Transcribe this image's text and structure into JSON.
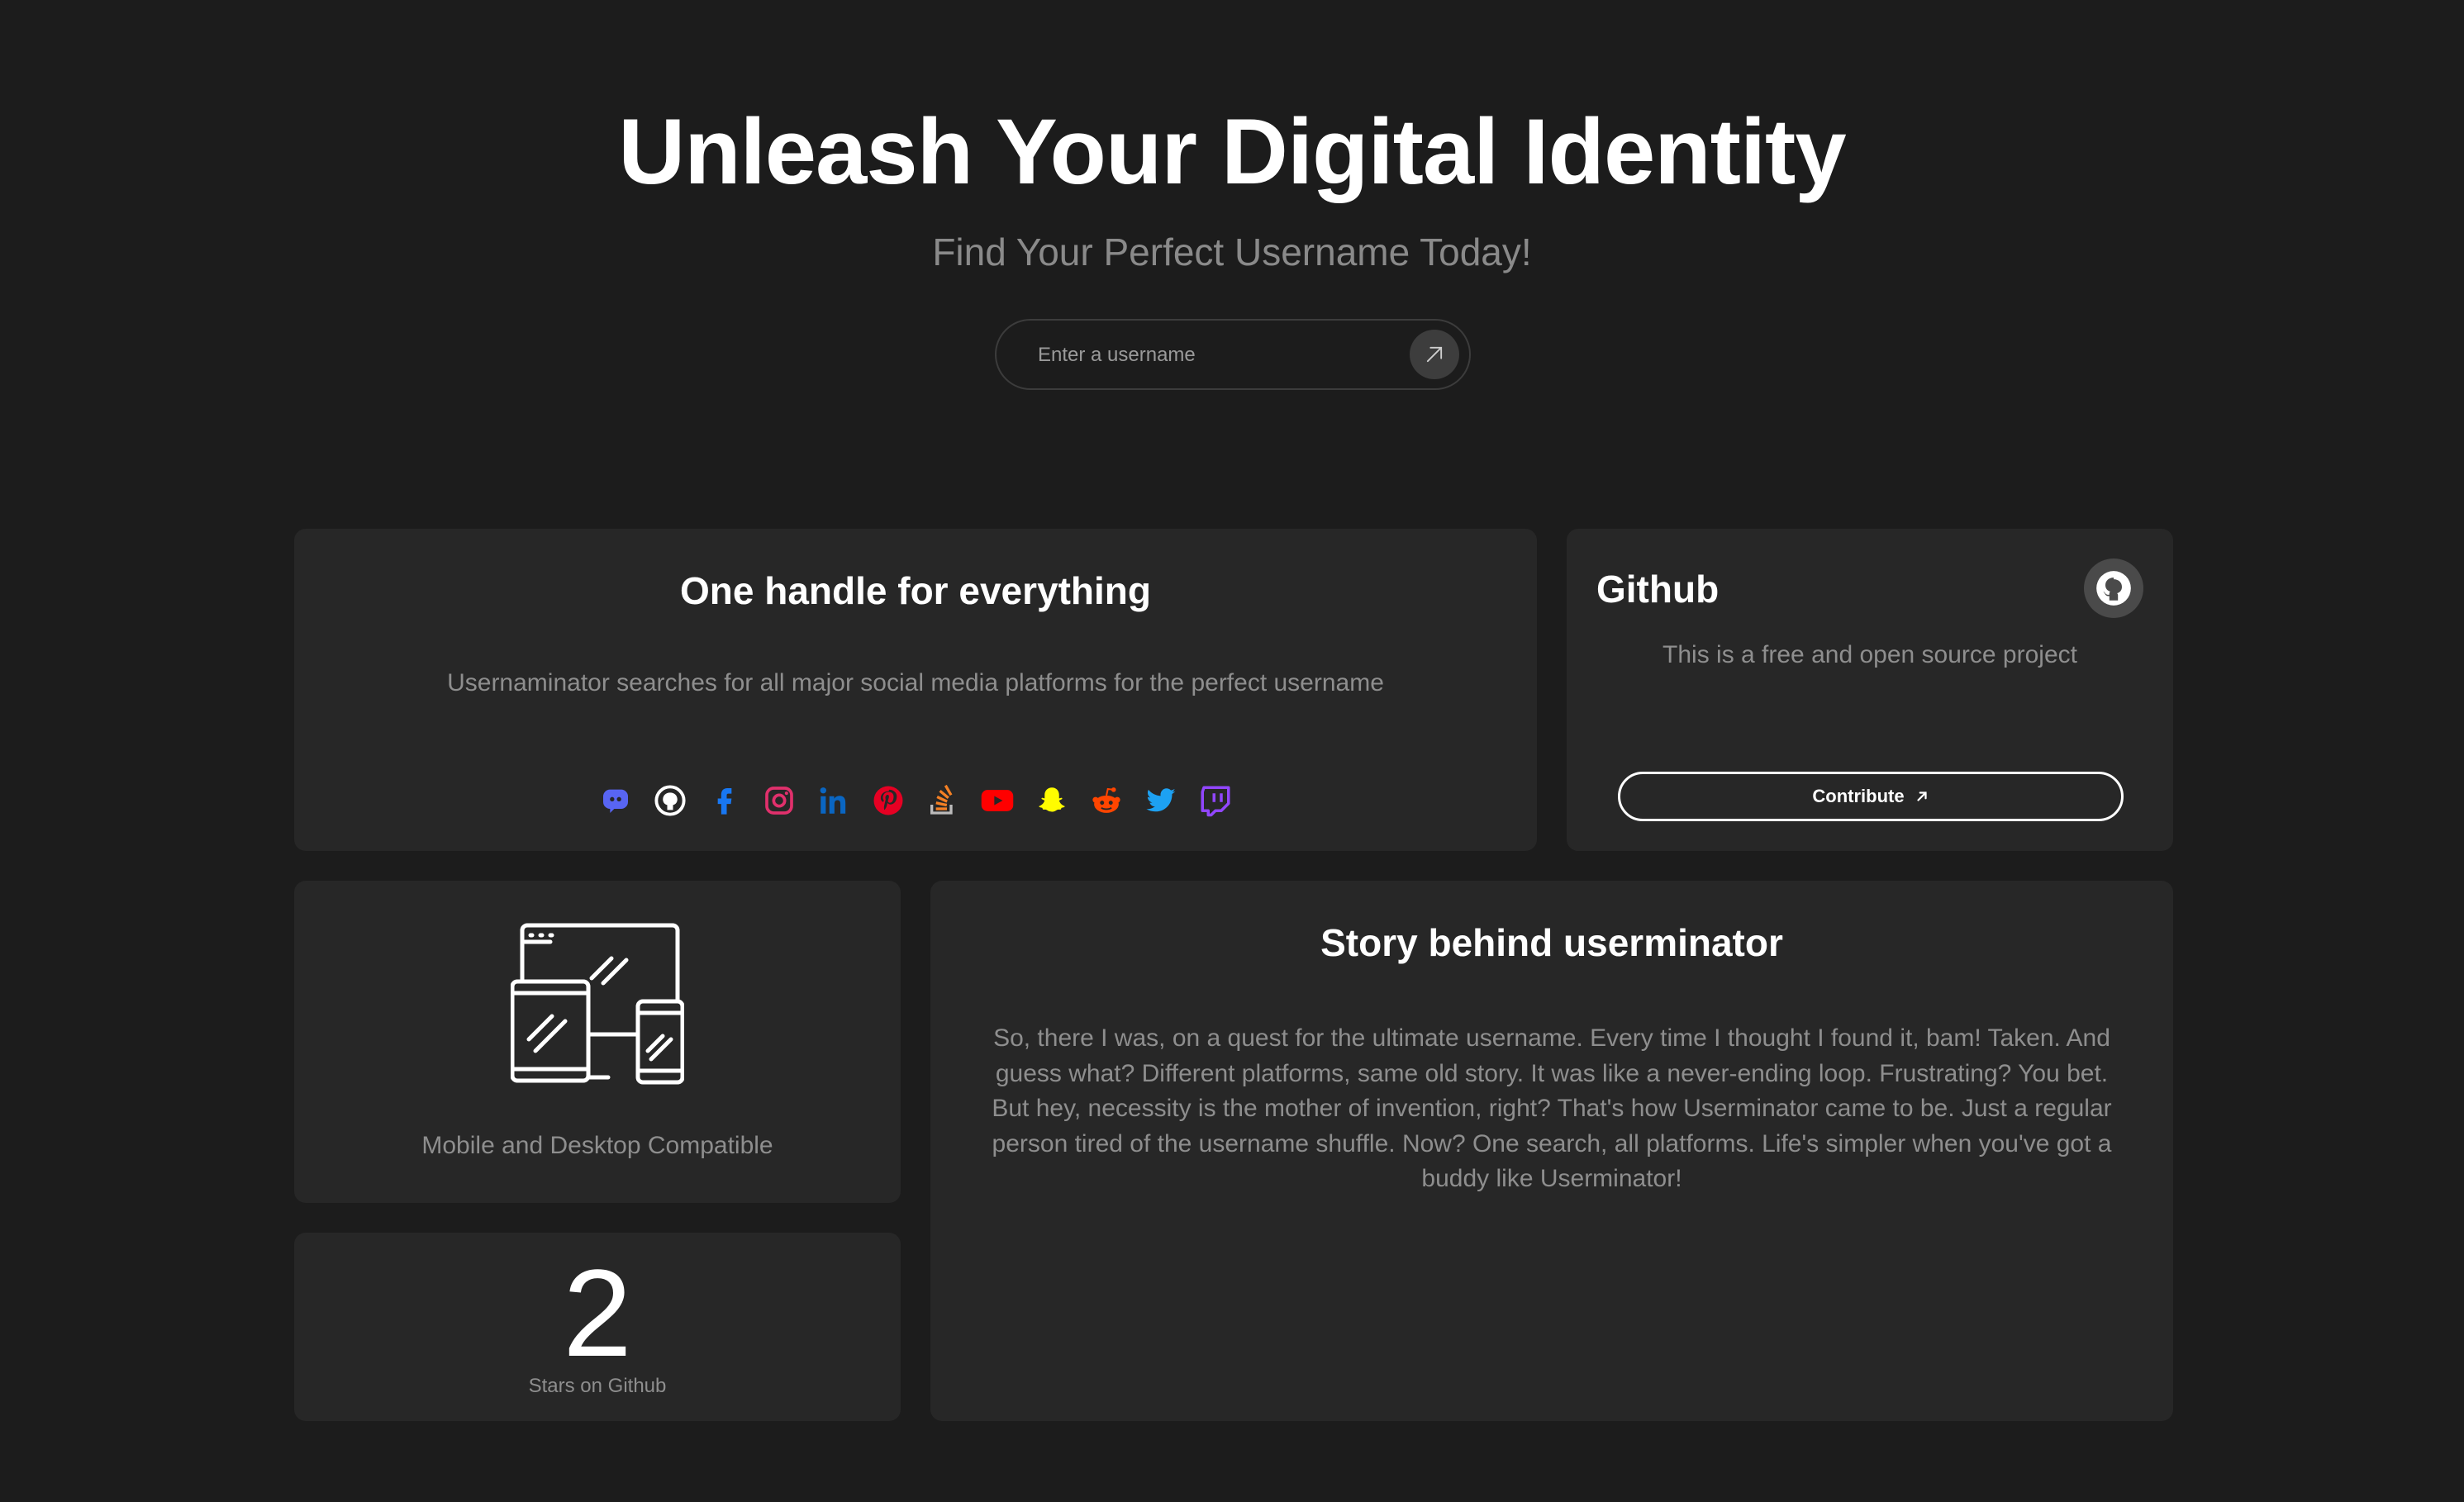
{
  "hero": {
    "title": "Unleash Your Digital Identity",
    "subtitle": "Find Your Perfect Username Today!"
  },
  "search": {
    "placeholder": "Enter a username",
    "submit_icon": "arrow-up-right-icon"
  },
  "handle_card": {
    "title": "One handle for everything",
    "description": "Usernaminator searches for all major social media platforms for the perfect username",
    "platforms": [
      {
        "name": "discord-icon",
        "color": "#5865f2"
      },
      {
        "name": "github-icon",
        "color": "#ffffff"
      },
      {
        "name": "facebook-icon",
        "color": "#1877f2"
      },
      {
        "name": "instagram-icon",
        "color": "#e1306c"
      },
      {
        "name": "linkedin-icon",
        "color": "#0a66c2"
      },
      {
        "name": "pinterest-icon",
        "color": "#e60023"
      },
      {
        "name": "stackoverflow-icon",
        "color": "#f48024"
      },
      {
        "name": "youtube-icon",
        "color": "#ff0000"
      },
      {
        "name": "snapchat-icon",
        "color": "#fffc00"
      },
      {
        "name": "reddit-icon",
        "color": "#ff4500"
      },
      {
        "name": "twitter-icon",
        "color": "#1da1f2"
      },
      {
        "name": "twitch-icon",
        "color": "#9146ff"
      }
    ]
  },
  "github_card": {
    "title": "Github",
    "description": "This is a free and open source project",
    "contribute_label": "Contribute",
    "icon": "github-icon"
  },
  "compat_card": {
    "icon": "devices-icon",
    "label": "Mobile and Desktop Compatible"
  },
  "story_card": {
    "title": "Story behind userminator",
    "body": "So, there I was, on a quest for the ultimate username. Every time I thought I found it, bam! Taken. And guess what? Different platforms, same old story. It was like a never-ending loop. Frustrating? You bet. But hey, necessity is the mother of invention, right? That's how Userminator came to be. Just a regular person tired of the username shuffle. Now? One search, all platforms. Life's simpler when you've got a buddy like Userminator!"
  },
  "stars_card": {
    "count": "2",
    "label": "Stars on Github"
  },
  "colors": {
    "background": "#1c1c1c",
    "card": "#272727",
    "muted_text": "#8e8e8e"
  }
}
